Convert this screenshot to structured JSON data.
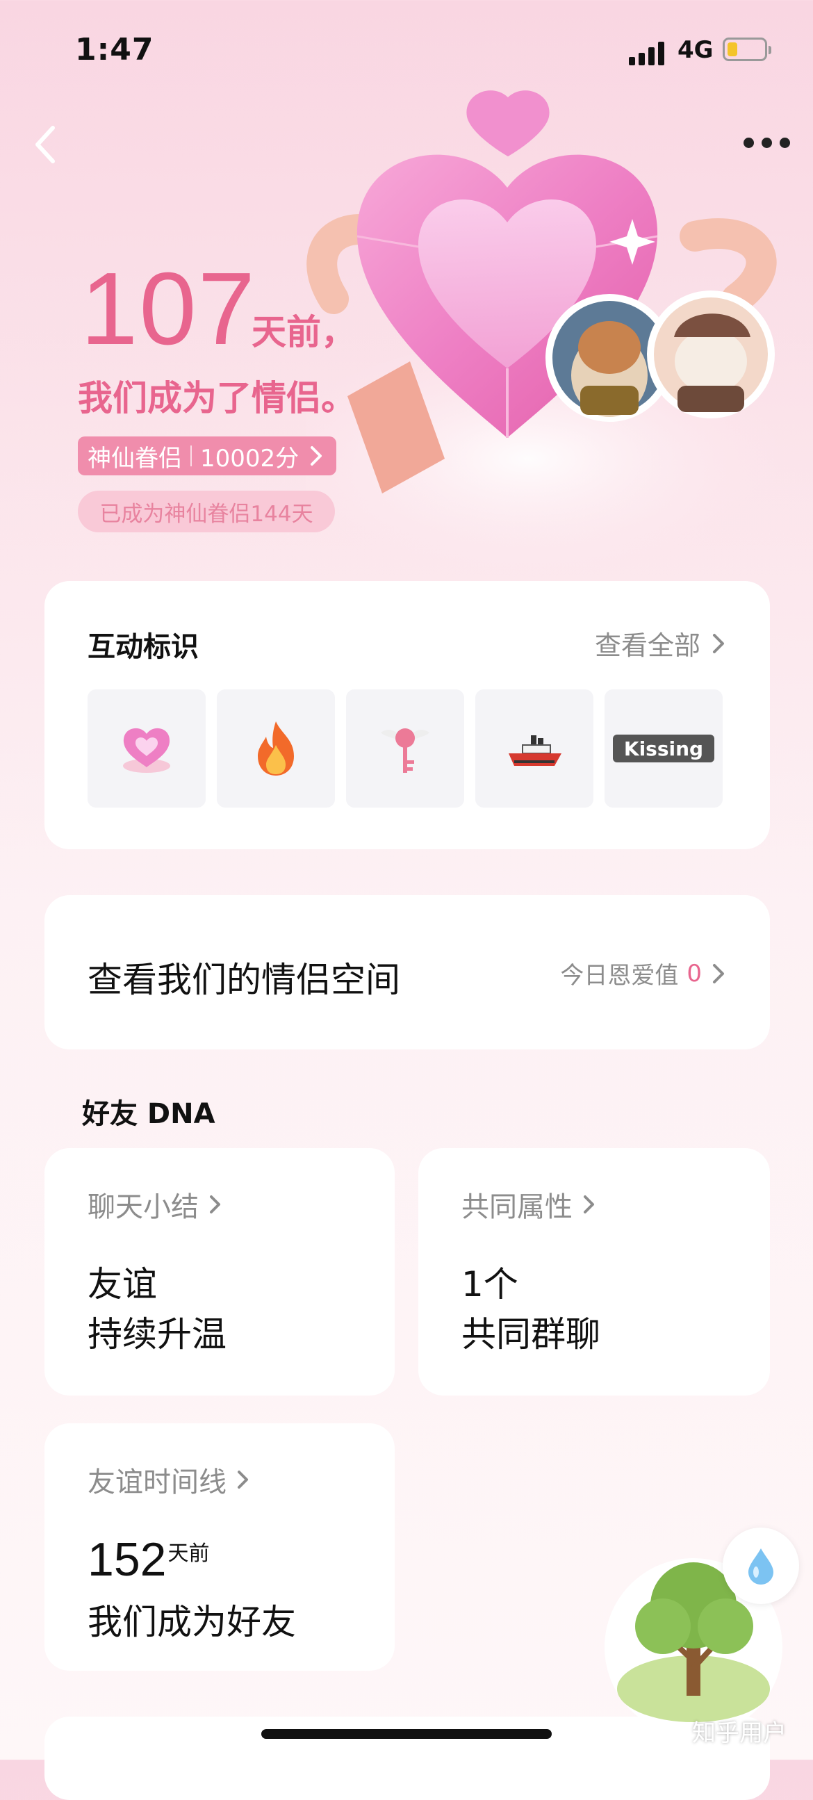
{
  "status_bar": {
    "time": "1:47",
    "network": "4G"
  },
  "hero": {
    "days": "107",
    "days_unit": "天前，",
    "became": "我们成为了情侣。",
    "tag_name": "神仙眷侣",
    "tag_score": "10002分",
    "sub_tag": "已成为神仙眷侣144天"
  },
  "interaction": {
    "title": "互动标识",
    "view_all": "查看全部",
    "badges": [
      "heart-gem-icon",
      "flame-icon",
      "winged-key-icon",
      "ship-icon",
      "kissing-icon"
    ]
  },
  "couple_space": {
    "label": "查看我们的情侣空间",
    "love_label": "今日恩爱值",
    "love_value": "0"
  },
  "dna": {
    "title": "好友 DNA",
    "chat_summary": {
      "head": "聊天小结",
      "line1": "友谊",
      "line2": "持续升温"
    },
    "common": {
      "head": "共同属性",
      "line1": "1个",
      "line2": "共同群聊"
    },
    "timeline": {
      "head": "友谊时间线",
      "num": "152",
      "unit": "天前",
      "line2": "我们成为好友"
    }
  },
  "watermark": "知乎用户",
  "colors": {
    "accent": "#e8658e",
    "tag_bg": "#f08dac",
    "card_bg": "#ffffff"
  }
}
